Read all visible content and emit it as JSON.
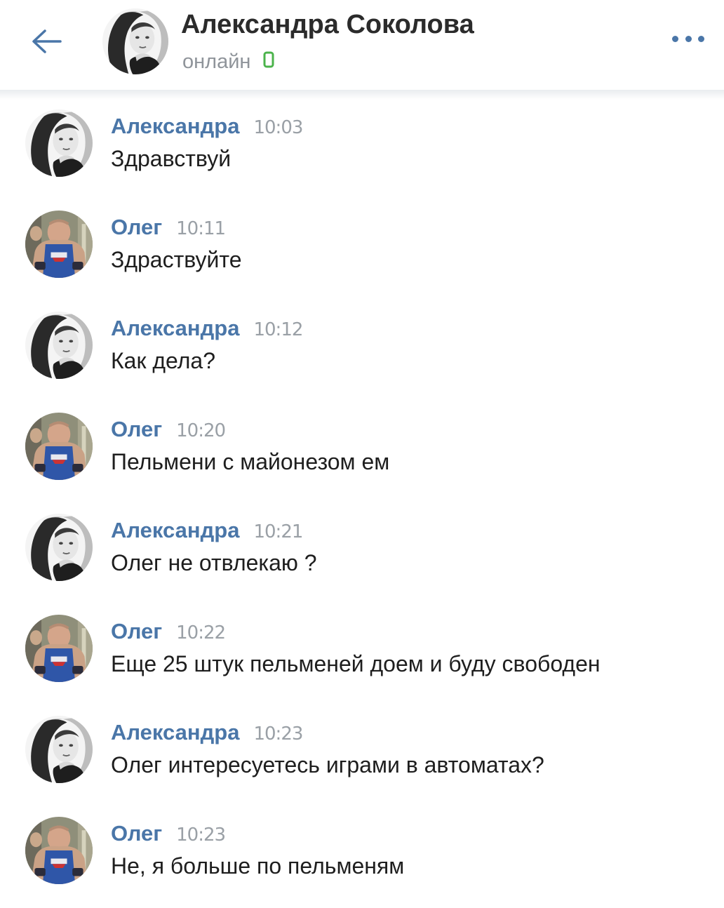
{
  "header": {
    "title": "Александра Соколова",
    "status": "онлайн"
  },
  "icons": {
    "back": "arrow-left-icon",
    "more": "more-horizontal-icon",
    "mobile": "mobile-online-icon"
  },
  "colors": {
    "accent": "#4a76a8",
    "online": "#4bb34b",
    "time": "#9aa0a6"
  },
  "messages": [
    {
      "author": "Александра",
      "time": "10:03",
      "text": "Здравствуй",
      "avatar": "alexandra"
    },
    {
      "author": "Олег",
      "time": "10:11",
      "text": "Здраствуйте",
      "avatar": "oleg"
    },
    {
      "author": "Александра",
      "time": "10:12",
      "text": "Как дела?",
      "avatar": "alexandra"
    },
    {
      "author": "Олег",
      "time": "10:20",
      "text": "Пельмени с майонезом ем",
      "avatar": "oleg"
    },
    {
      "author": "Александра",
      "time": "10:21",
      "text": "Олег не отвлекаю ?",
      "avatar": "alexandra"
    },
    {
      "author": "Олег",
      "time": "10:22",
      "text": "Еще 25 штук пельменей доем и буду свободен",
      "avatar": "oleg"
    },
    {
      "author": "Александра",
      "time": "10:23",
      "text": "Олег интересуетесь играми в автоматах?",
      "avatar": "alexandra"
    },
    {
      "author": "Олег",
      "time": "10:23",
      "text": "Не, я больше по пельменям",
      "avatar": "oleg"
    }
  ]
}
